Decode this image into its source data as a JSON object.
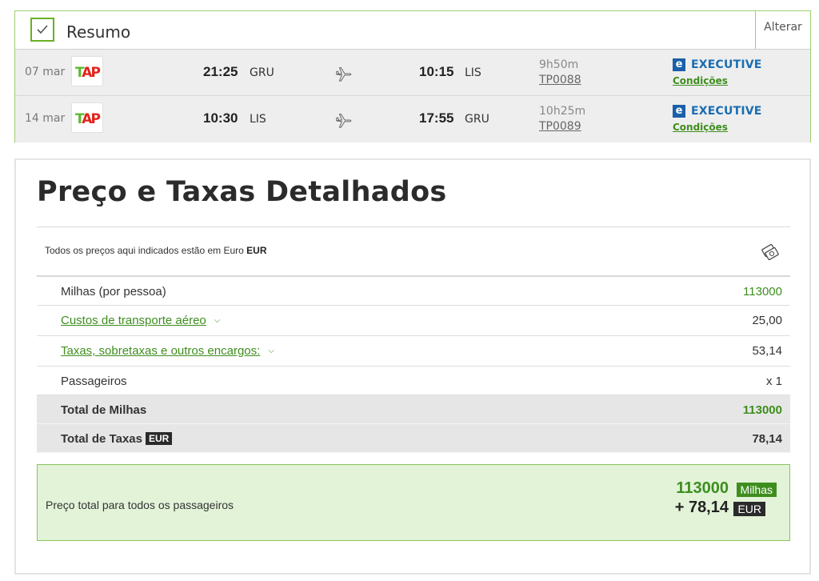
{
  "summary": {
    "title": "Resumo",
    "change_label": "Alterar",
    "flights": [
      {
        "date": "07 mar",
        "airline_logo": "TAP",
        "dep_time": "21:25",
        "dep_code": "GRU",
        "arr_time": "10:15",
        "arr_code": "LIS",
        "duration": "9h50m",
        "flight_number": "TP0088",
        "cabin": "EXECUTIVE",
        "conditions": "Condições"
      },
      {
        "date": "14 mar",
        "airline_logo": "TAP",
        "dep_time": "10:30",
        "dep_code": "LIS",
        "arr_time": "17:55",
        "arr_code": "GRU",
        "duration": "10h25m",
        "flight_number": "TP0089",
        "cabin": "EXECUTIVE",
        "conditions": "Condições"
      }
    ]
  },
  "details": {
    "title": "Preço e Taxas Detalhados",
    "currency_note": "Todos os preços aqui indicados estão em Euro",
    "currency_code": "EUR",
    "rows": [
      {
        "label": "Milhas (por pessoa)",
        "value": "113000"
      },
      {
        "label": "Custos de transporte aéreo",
        "value": "25,00"
      },
      {
        "label": "Taxas, sobretaxas e outros encargos:",
        "value": "53,14"
      },
      {
        "label": "Passageiros",
        "value": "x 1"
      },
      {
        "label": "Total de Milhas",
        "value": "113000"
      },
      {
        "label": "Total de Taxas",
        "badge": "EUR",
        "value": "78,14"
      }
    ],
    "total": {
      "label": "Preço total para todos os passageiros",
      "miles": "113000",
      "miles_badge": "Milhas",
      "tax": "+ 78,14",
      "tax_badge": "EUR"
    }
  },
  "colors": {
    "accent_green": "#3e8e1e",
    "light_green_bg": "#e2f3d8",
    "exec_blue": "#1a6db3"
  }
}
